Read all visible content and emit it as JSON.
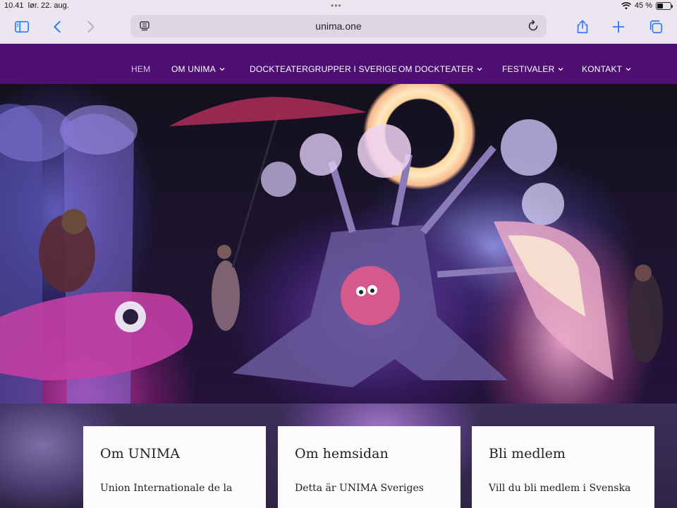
{
  "status": {
    "time": "10.41",
    "date": "lør. 22. aug.",
    "battery_percent": "45 %",
    "battery_level": 0.45
  },
  "browser": {
    "url": "unima.one",
    "icons": [
      "sidebar-icon",
      "back-icon",
      "forward-icon",
      "page-menu-icon",
      "reload-icon",
      "share-icon",
      "new-tab-icon",
      "tabs-icon"
    ]
  },
  "nav": {
    "items": [
      {
        "label": "HEM",
        "dropdown": false
      },
      {
        "label": "OM UNIMA",
        "dropdown": true
      },
      {
        "label": "DOCKTEATERGRUPPER I SVERIGE",
        "dropdown": false
      },
      {
        "label": "OM DOCKTEATER",
        "dropdown": true
      },
      {
        "label": "FESTIVALER",
        "dropdown": true
      },
      {
        "label": "KONTAKT",
        "dropdown": true
      }
    ]
  },
  "cards": [
    {
      "title": "Om UNIMA",
      "text": "Union Internationale de la"
    },
    {
      "title": "Om hemsidan",
      "text": "Detta är UNIMA Sveriges"
    },
    {
      "title": "Bli medlem",
      "text": "Vill du bli medlem i Svenska"
    }
  ],
  "colors": {
    "nav_bg": "#4d0f72",
    "accent": "#2a7cf6"
  }
}
